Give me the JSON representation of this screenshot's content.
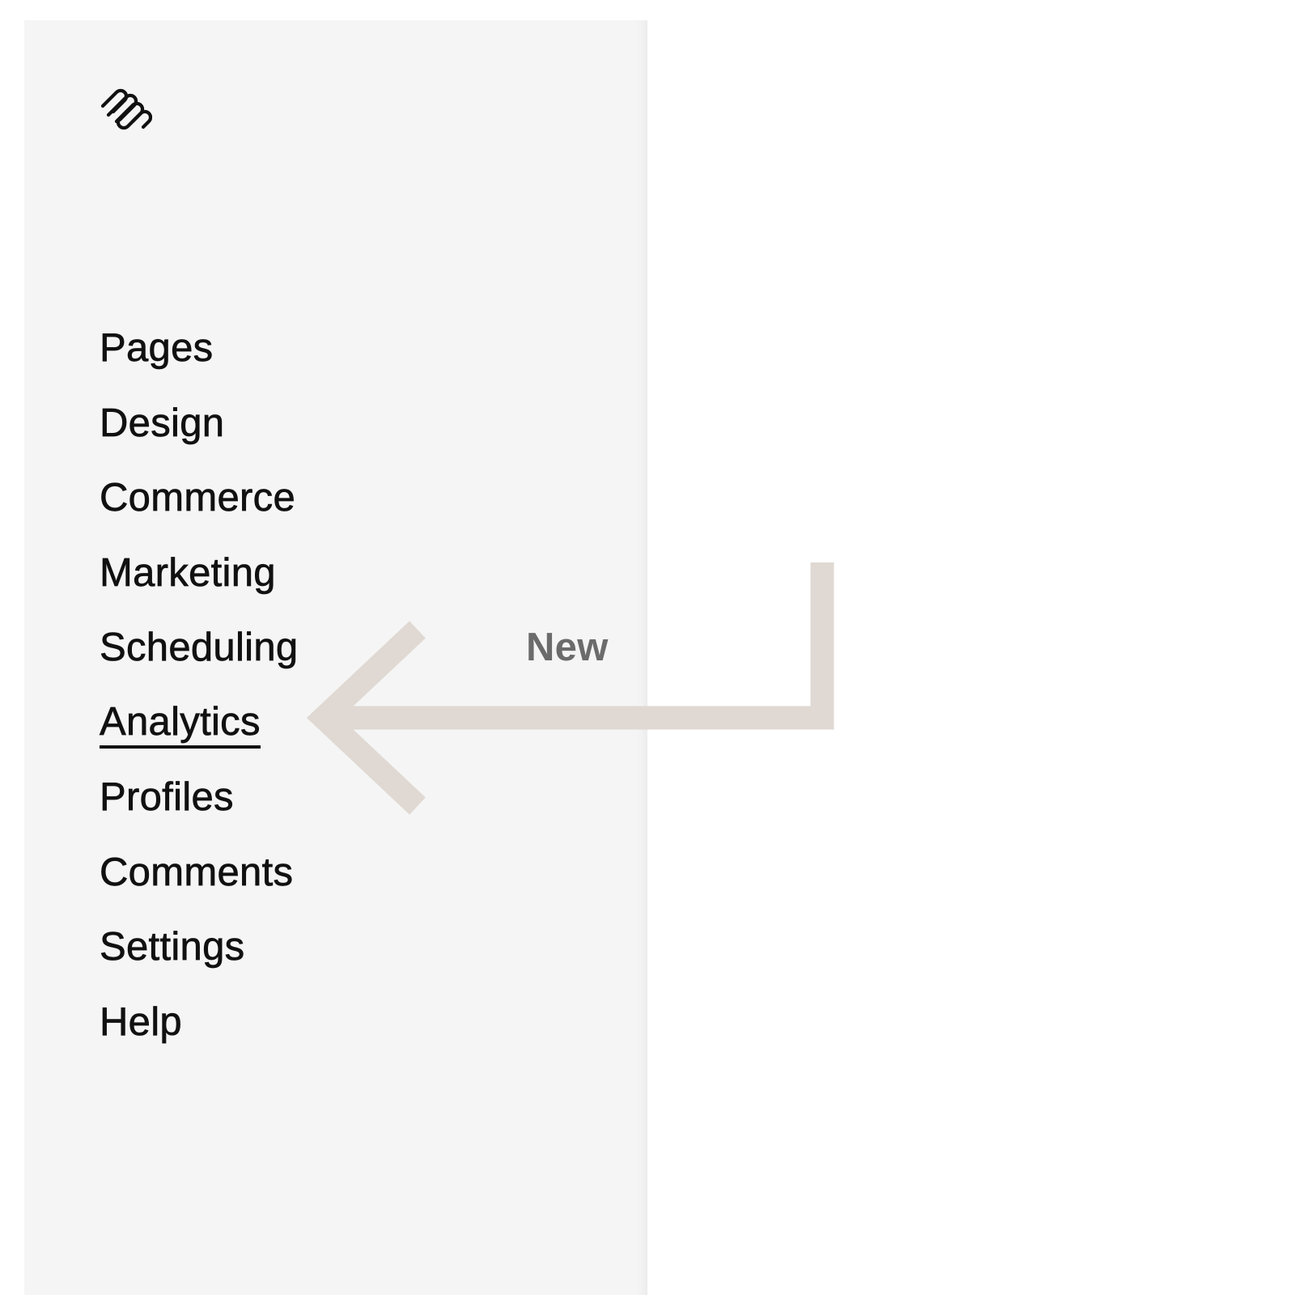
{
  "logo": {
    "icon": "squarespace-logo-icon"
  },
  "nav": {
    "items": [
      {
        "label": "Pages"
      },
      {
        "label": "Design"
      },
      {
        "label": "Commerce"
      },
      {
        "label": "Marketing"
      },
      {
        "label": "Scheduling",
        "badge": "New"
      },
      {
        "label": "Analytics",
        "active": true
      },
      {
        "label": "Profiles"
      },
      {
        "label": "Comments"
      },
      {
        "label": "Settings"
      },
      {
        "label": "Help"
      }
    ]
  },
  "colors": {
    "sidebar_bg": "#f5f5f5",
    "text": "#111111",
    "badge_text": "#6b6b6b",
    "arrow": "#e0d9d3"
  }
}
